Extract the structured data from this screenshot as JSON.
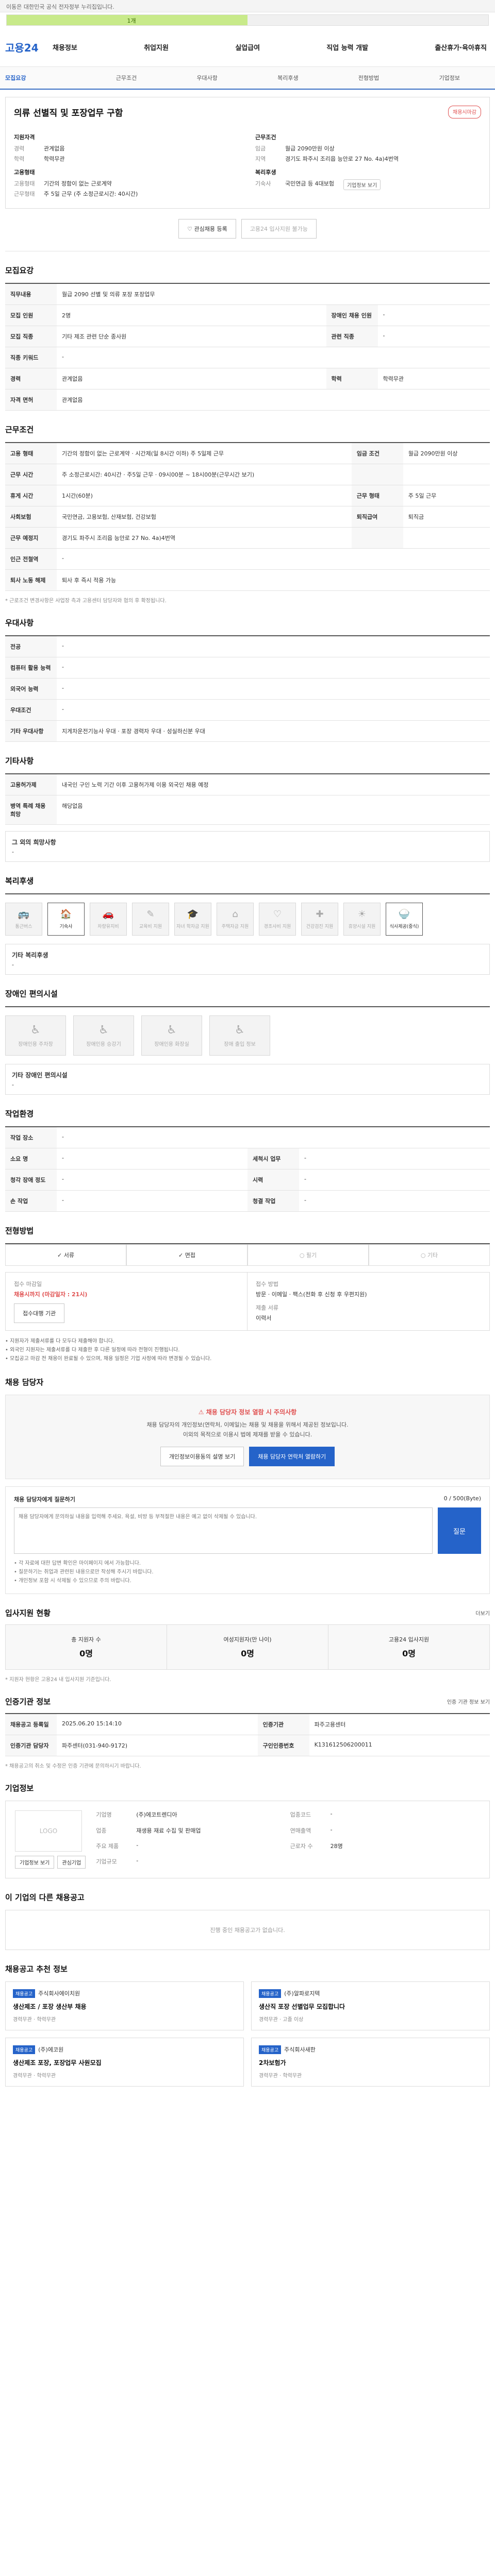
{
  "topbar": {
    "text": "이동은 대한민국 공식 전자정부 누리집입니다."
  },
  "progress": {
    "percent": 50,
    "label": "1개"
  },
  "nav": {
    "logo": "고용24",
    "items": [
      "채용정보",
      "취업지원",
      "실업급여",
      "직업 능력 개발",
      "출산휴가·육아휴직"
    ]
  },
  "subnav": [
    "모집요강",
    "근무조건",
    "우대사항",
    "복리후생",
    "전형방법",
    "기업정보"
  ],
  "job": {
    "title": "의류 선별직 및 포장업무 구함",
    "badge": "채용시마감",
    "qualification_title": "지원자격",
    "career": {
      "k": "경력",
      "v": "관계없음"
    },
    "education": {
      "k": "학력",
      "v": "학력무관"
    },
    "conditions_title": "근무조건",
    "region": {
      "k": "임금",
      "v": "월급 2090만원 이상"
    },
    "location": {
      "k": "지역",
      "v": "경기도 파주시 조리읍 능안로 27 No. 4a)4번역"
    },
    "form_title": "고용형태",
    "form1": {
      "k": "고용형태",
      "v": "기간의 정함이 없는 근로계약"
    },
    "form2": {
      "k": "근무형태",
      "v": "주 5일 근무 (주 소정근로시간: 40시간)"
    },
    "welfare_title": "복리후생",
    "welfare": {
      "k": "기숙사",
      "v": "국민연금 등 4대보험"
    },
    "chip": "기업정보 보기"
  },
  "actions": {
    "interest": "관심채용 등록",
    "apply": "고용24 입사지원 불가능"
  },
  "recruit": {
    "title": "모집요강",
    "rows": [
      {
        "k": "직무내용",
        "v": "월급 2090 선별 및 의류 포장 포장업무"
      },
      {
        "k": "모집 인원",
        "v": "2명",
        "k2": "장애인 채용 인원",
        "v2": "-"
      },
      {
        "k": "모집 직종",
        "v": "기타 제조 관련 단순 종사원",
        "k2": "관련 직종",
        "v2": "-"
      },
      {
        "k": "직종 키워드",
        "v": "-"
      },
      {
        "k": "경력",
        "v": "관계없음",
        "k2": "학력",
        "v2": "학력무관"
      },
      {
        "k": "자격 면허",
        "v": "관계없음"
      }
    ]
  },
  "work": {
    "title": "근무조건",
    "rows": [
      {
        "k": "고용 형태",
        "v": "기간의 정함이 없는 근로계약 · 시간제(일 8시간 이하) 주 5일제 근무",
        "k2": "임금 조건",
        "v2": "월급 2090만원 이상"
      },
      {
        "k": "근무 시간",
        "v": "주 소정근로시간: 40시간 · 주5일 근무 · 09시00분 ~ 18시00분(근무시간 보기)",
        "k2": "",
        "v2": ""
      },
      {
        "k": "휴게 시간",
        "v": "1시간(60분)",
        "k2": "근무 형태",
        "v2": "주 5일 근무"
      },
      {
        "k": "사회보험",
        "v": "국민연금, 고용보험, 산재보험, 건강보험",
        "k2": "퇴직급여",
        "v2": "퇴직금"
      },
      {
        "k": "근무 예정지",
        "v": "경기도 파주시 조리읍 능안로 27 No. 4a)4번역",
        "k2": "",
        "v2": ""
      },
      {
        "k": "인근 전철역",
        "v": "-"
      },
      {
        "k": "퇴사 노동 해제",
        "v": "퇴사 후 즉시 적용 가능"
      }
    ],
    "note": "* 근로조건 변경사항은 사업장 측과 고용센터 담당자와 협의 후 확정됩니다."
  },
  "prefer": {
    "title": "우대사항",
    "rows": [
      {
        "k": "전공",
        "v": "-"
      },
      {
        "k": "컴퓨터 활용 능력",
        "v": "-"
      },
      {
        "k": "외국어 능력",
        "v": "-"
      },
      {
        "k": "우대조건",
        "v": "-"
      },
      {
        "k": "기타 우대사항",
        "v": "지게차운전기능사 우대 · 포장 경력자 우대 · 성실하신분 우대"
      }
    ]
  },
  "etc": {
    "title": "기타사항",
    "rows": [
      {
        "k": "고용허가제",
        "v": "내국인 구인 노력 기간 이후 고용허가제 이용 외국인 채용 예정"
      },
      {
        "k": "병역 특례 채용 희망",
        "v": "해당없음"
      }
    ],
    "box_title": "그 외의 희망사항",
    "box_value": "-"
  },
  "welfare": {
    "title": "복리후생",
    "items": [
      {
        "label": "통근버스",
        "on": false,
        "g": "🚌"
      },
      {
        "label": "기숙사",
        "on": true,
        "g": "🏠"
      },
      {
        "label": "차량유지비",
        "on": false,
        "g": "🚗"
      },
      {
        "label": "교육비 지원",
        "on": false,
        "g": "✎"
      },
      {
        "label": "자녀 학자금 지원",
        "on": false,
        "g": "🎓"
      },
      {
        "label": "주택자금 지원",
        "on": false,
        "g": "⌂"
      },
      {
        "label": "경조사비 지원",
        "on": false,
        "g": "♡"
      },
      {
        "label": "건강검진 지원",
        "on": false,
        "g": "✚"
      },
      {
        "label": "휴양시설 지원",
        "on": false,
        "g": "☀"
      },
      {
        "label": "식사제공(중식)",
        "on": true,
        "g": "🍚"
      }
    ],
    "box_title": "기타 복리후생",
    "box_value": "-"
  },
  "disabled": {
    "title": "장애인 편의시설",
    "items": [
      "장애인용 주차장",
      "장애인용 승강기",
      "장애인용 화장실",
      "장애 출입 정보"
    ],
    "box_title": "기타 장애인 편의시설",
    "box_value": "-"
  },
  "workplace": {
    "title": "작업환경",
    "rows": [
      {
        "k": "작업 장소",
        "v": "-"
      },
      {
        "k": "소요 명",
        "v": "-",
        "k2": "세척시 업무",
        "v2": "-"
      },
      {
        "k": "청각 장애 정도",
        "v": "-",
        "k2": "시력",
        "v2": "-"
      },
      {
        "k": "손 작업",
        "v": "-",
        "k2": "청결 작업",
        "v2": "-"
      }
    ]
  },
  "method": {
    "title": "전형방법",
    "types": [
      {
        "label": "서류",
        "on": true
      },
      {
        "label": "면접",
        "on": true
      },
      {
        "label": "필기",
        "on": false
      },
      {
        "label": "기타",
        "on": false
      }
    ],
    "deadline_label": "접수 마감일",
    "deadline": "채용시까지 (마감일자 : 21시)",
    "deadline_btn": "접수대행 기관",
    "way_label": "접수 방법",
    "way": "방문 · 이메일 · 팩스(전화 후 신청 후 우편지원)",
    "docs_label": "제출 서류",
    "docs": "이력서",
    "notes": [
      "지원자가 제출서류를 다 모두다 제출해야 합니다.",
      "외국인 지원자는 제출서류를 다 제출한 후 다른 일정에 따라 전형이 진행됩니다.",
      "모집공고 마감 전 채용이 완료될 수 있으며, 채용 일정은 기업 사정에 따라 변경될 수 있습니다."
    ]
  },
  "contact": {
    "title": "채용 담당자",
    "warn": "채용 담당자 정보 열람 시 주의사항",
    "desc1": "채용 담당자의 개인정보(연락처, 이메일)는 채용 및 채용을 위해서 제공된 정보입니다.",
    "desc2": "이외의 목적으로 이용시 법에 제재를 받을 수 있습니다.",
    "btn1": "개인정보이용동의 설명 보기",
    "btn2": "채용 담당자 연락처 열람하기"
  },
  "question": {
    "title": "채용 담당자에게 질문하기",
    "count": "0 / 500(Byte)",
    "placeholder": "채용 담당자에게 문의하실 내용을 입력해 주세요. 욕설, 비방 등 부적절한 내용은 예고 없이 삭제될 수 있습니다.",
    "submit": "질문",
    "notes": [
      "각 자료에 대한 답변 확인은 마이페이지 에서 가능합니다.",
      "질문하기는 취업과 관련된 내용으로만 작성해 주시기 바랍니다.",
      "개인정보 포함 시 삭제될 수 있으므로 주의 바랍니다."
    ]
  },
  "status": {
    "title": "입사지원 현황",
    "more": "더보기",
    "items": [
      {
        "label": "총 지원자 수",
        "value": "0명"
      },
      {
        "label": "여성지원자(만 나이)",
        "value": "0명"
      },
      {
        "label": "고용24 입사지원",
        "value": "0명"
      }
    ],
    "note": "* 지원자 현황은 고용24 내 입사지원 기준입니다."
  },
  "history": {
    "title": "인증기관 정보",
    "more": "인증 기관 정보 보기",
    "rows": [
      {
        "k": "채용공고 등록일",
        "v": "2025.06.20 15:14:10",
        "k2": "인증기관",
        "v2": "파주고용센터"
      },
      {
        "k": "인증기관 담당자",
        "v": "파주센터(031-940-9172)",
        "k2": "구인인증번호",
        "v2": "K131612506200011"
      }
    ],
    "note": "* 채용공고의 취소 및 수정은 인증 기관에 문의하시기 바랍니다."
  },
  "company": {
    "title": "기업정보",
    "logo": "LOGO",
    "btn1": "기업정보 보기",
    "btn2": "관심기업",
    "rows": [
      {
        "k": "기업명",
        "v": "(주)에코트렌디아",
        "k2": "업종코드",
        "v2": "-"
      },
      {
        "k": "업종",
        "v": "재생용 재료 수집 및 판매업",
        "k2": "연매출액",
        "v2": "-"
      },
      {
        "k": "주요 제품",
        "v": "-",
        "k2": "근로자 수",
        "v2": "28명"
      },
      {
        "k": "기업규모",
        "v": "-",
        "k2": "",
        "v2": ""
      }
    ]
  },
  "others": {
    "title": "이 기업의 다른 채용공고",
    "empty": "진행 중인 채용공고가 없습니다."
  },
  "recommend": {
    "title": "채용공고 추천 정보",
    "items": [
      {
        "tag": "채용공고",
        "company": "주식회사에이치원",
        "title": "생산제조 / 포장 생산부 채용",
        "meta": "경력무관 · 학력무관"
      },
      {
        "tag": "채용공고",
        "company": "(주)알파로지텍",
        "title": "생산직 포장 선별업무 모집합니다",
        "meta": "경력무관 · 고졸 이상"
      },
      {
        "tag": "채용공고",
        "company": "(주)에코원",
        "title": "생산제조 포장, 포장업무 사원모집",
        "meta": "경력무관 · 학력무관"
      },
      {
        "tag": "채용공고",
        "company": "주식회사새한",
        "title": "2차보험가",
        "meta": "경력무관 · 학력무관"
      }
    ]
  }
}
